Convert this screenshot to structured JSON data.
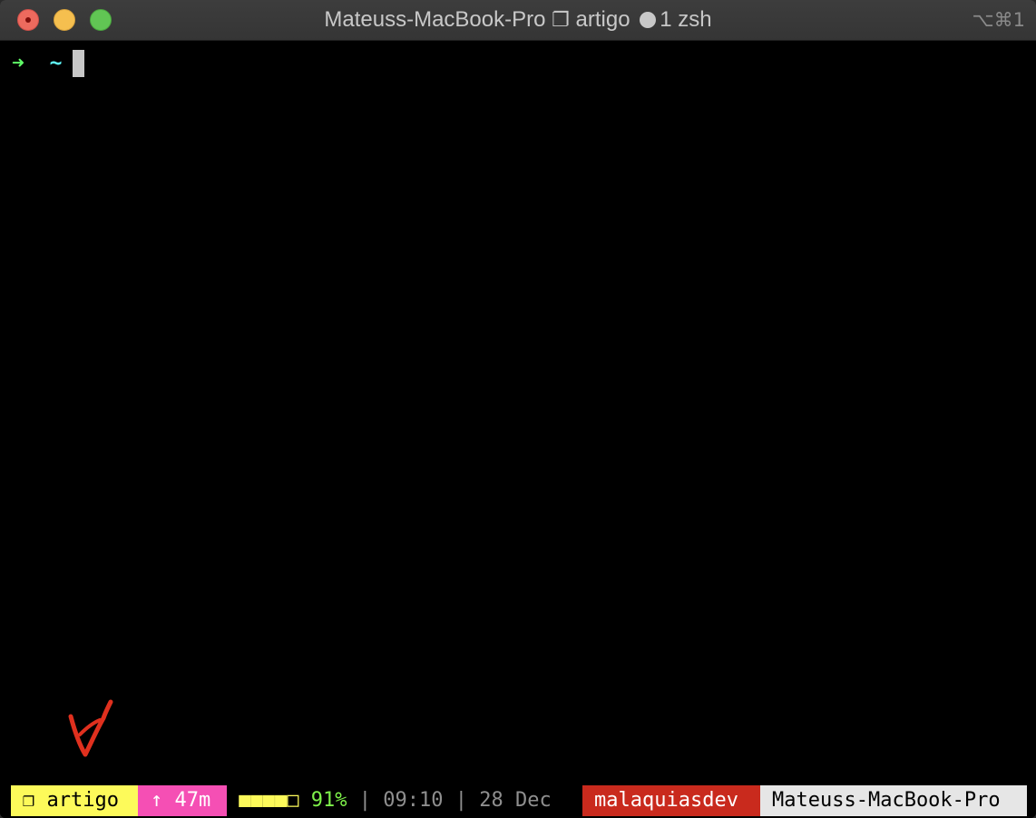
{
  "window": {
    "title_host": "Mateuss-MacBook-Pro",
    "title_tab_icon": "❐",
    "title_session": "artigo",
    "title_window": "1 zsh",
    "shortcut": "⌥⌘1"
  },
  "terminal": {
    "prompt_arrow": "➜",
    "prompt_cwd": "~"
  },
  "statusbar": {
    "session": "❐ artigo",
    "uptime": "↑ 47m",
    "battery_bar": "■■■■□",
    "battery_pct": "91%",
    "sep": "|",
    "time": "09:10",
    "date": "28 Dec",
    "user": "malaquiasdev",
    "host": "Mateuss-MacBook-Pro"
  },
  "colors": {
    "session_bg": "#fdfa5a",
    "uptime_bg": "#f54fb4",
    "user_bg": "#c92a1d",
    "host_bg": "#e6e6e6",
    "annotation": "#e0301e"
  }
}
